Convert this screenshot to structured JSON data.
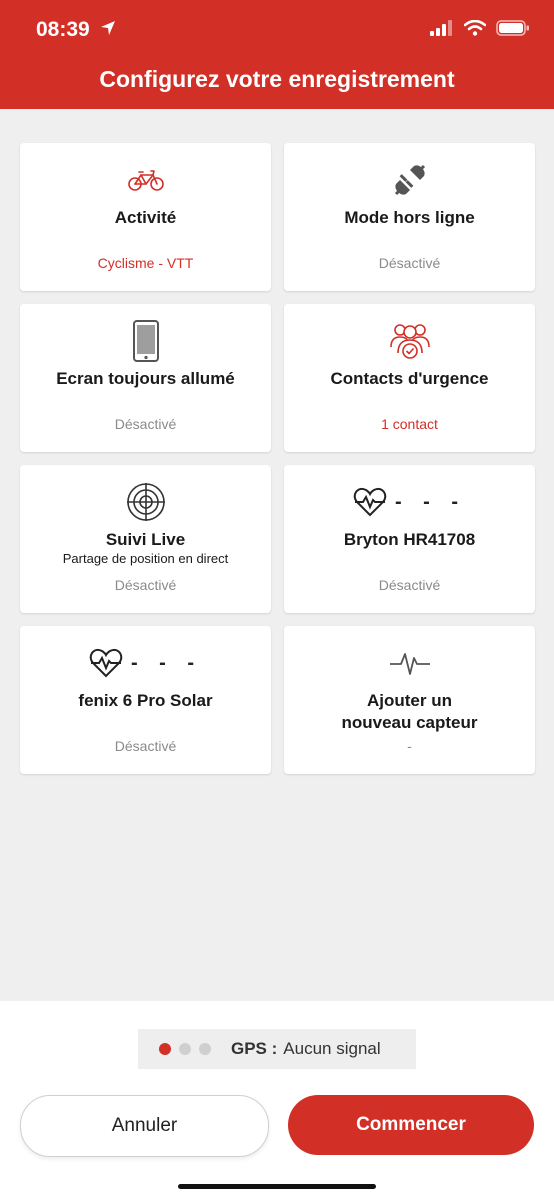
{
  "status_bar": {
    "time": "08:39"
  },
  "header": {
    "title": "Configurez votre enregistrement"
  },
  "cards": [
    {
      "title": "Activité",
      "status": "Cyclisme - VTT",
      "icon": "bicycle-icon"
    },
    {
      "title": "Mode hors ligne",
      "status": "Désactivé",
      "icon": "plug-icon"
    },
    {
      "title": "Ecran toujours allumé",
      "status": "Désactivé",
      "icon": "phone-icon"
    },
    {
      "title": "Contacts d'urgence",
      "status": "1 contact",
      "icon": "contacts-icon"
    },
    {
      "title": "Suivi Live",
      "subtitle": "Partage de position en direct",
      "status": "Désactivé",
      "icon": "target-icon"
    },
    {
      "title": "Bryton HR41708",
      "status": "Désactivé",
      "icon": "heart-rate-icon",
      "dashes": "- - -"
    },
    {
      "title": "fenix 6 Pro Solar",
      "status": "Désactivé",
      "icon": "heart-rate-icon",
      "dashes": "- - -"
    },
    {
      "title_line1": "Ajouter un",
      "title_line2": "nouveau capteur",
      "status": "-",
      "icon": "sensor-pulse-icon"
    }
  ],
  "gps": {
    "label": "GPS :",
    "value": "Aucun signal"
  },
  "buttons": {
    "cancel": "Annuler",
    "start": "Commencer"
  },
  "colors": {
    "accent": "#d22f27",
    "muted": "#8a8a8a",
    "background": "#efefef"
  }
}
